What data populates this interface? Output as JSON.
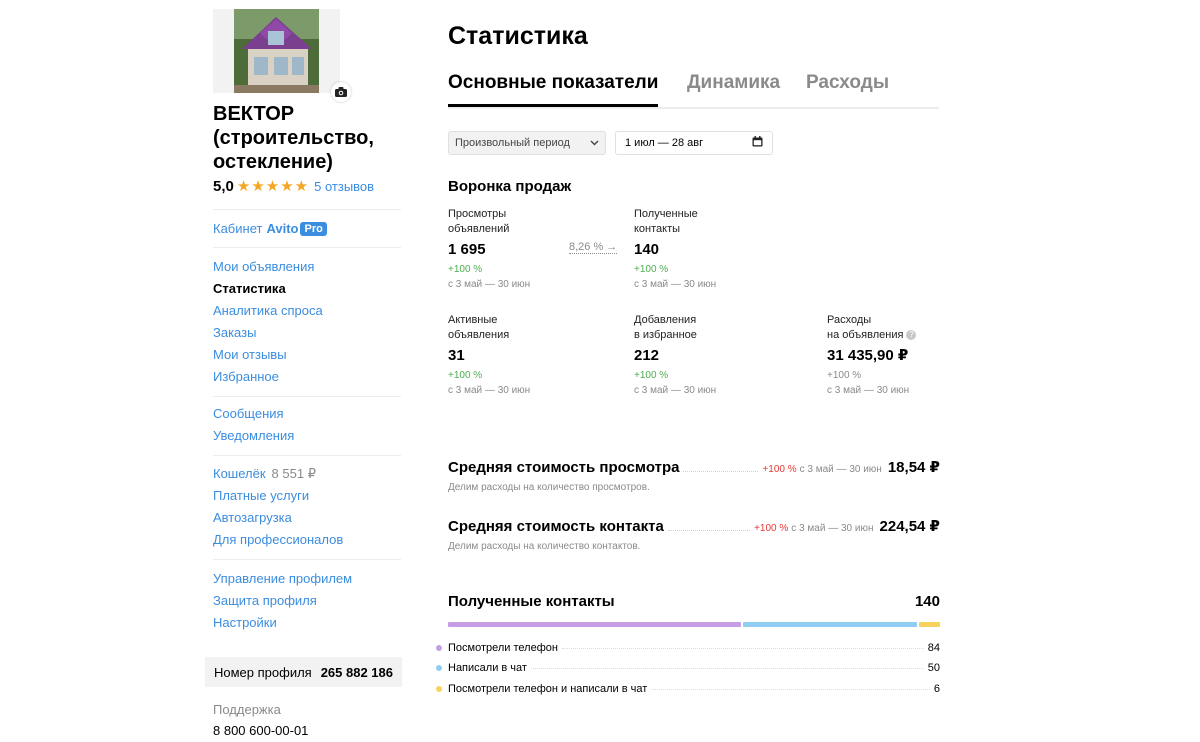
{
  "sidebar": {
    "company_name": "ВЕКТОР (строительство, остекление)",
    "rating": "5,0",
    "stars": 5,
    "reviews": "5 отзывов",
    "cabinet_label": "Кабинет",
    "cabinet_brand": "Avito",
    "cabinet_badge": "Pro",
    "nav_group1": [
      {
        "label": "Мои объявления",
        "active": false
      },
      {
        "label": "Статистика",
        "active": true
      },
      {
        "label": "Аналитика спроса",
        "active": false
      },
      {
        "label": "Заказы",
        "active": false
      },
      {
        "label": "Мои отзывы",
        "active": false
      },
      {
        "label": "Избранное",
        "active": false
      }
    ],
    "nav_group2": [
      {
        "label": "Сообщения"
      },
      {
        "label": "Уведомления"
      }
    ],
    "wallet_label": "Кошелёк",
    "wallet_amount": "8 551 ₽",
    "nav_group3": [
      {
        "label": "Платные услуги"
      },
      {
        "label": "Автозагрузка"
      },
      {
        "label": "Для профессионалов"
      }
    ],
    "nav_group4": [
      {
        "label": "Управление профилем"
      },
      {
        "label": "Защита профиля"
      },
      {
        "label": "Настройки"
      }
    ],
    "profile_label": "Номер профиля",
    "profile_number": "265 882 186",
    "support_label": "Поддержка",
    "support_phone": "8 800 600-00-01"
  },
  "main": {
    "title": "Статистика",
    "tabs": [
      {
        "label": "Основные показатели",
        "active": true
      },
      {
        "label": "Динамика",
        "active": false
      },
      {
        "label": "Расходы",
        "active": false
      }
    ],
    "period_select": "Произвольный период",
    "date_range": "1 июл — 28 авг",
    "funnel_title": "Воронка продаж",
    "conversion": "8,26 %",
    "metrics": [
      {
        "label1": "Просмотры",
        "label2": "объявлений",
        "value": "1 695",
        "change": "+100 %",
        "period": "с 3 май — 30 июн"
      },
      {
        "label1": "Полученные",
        "label2": "контакты",
        "value": "140",
        "change": "+100 %",
        "period": "с 3 май — 30 июн"
      },
      {
        "label1": "Активные",
        "label2": "объявления",
        "value": "31",
        "change": "+100 %",
        "period": "с 3 май — 30 июн"
      },
      {
        "label1": "Добавления",
        "label2": "в избранное",
        "value": "212",
        "change": "+100 %",
        "period": "с 3 май — 30 июн"
      },
      {
        "label1": "Расходы",
        "label2": "на объявления",
        "value": "31 435,90 ₽",
        "change": "+100 %",
        "period": "с 3 май — 30 июн"
      }
    ],
    "cost_view": {
      "title": "Средняя стоимость просмотра",
      "change": "+100 %",
      "period": "с 3 май — 30 июн",
      "value": "18,54 ₽",
      "desc": "Делим расходы на количество просмотров."
    },
    "cost_contact": {
      "title": "Средняя стоимость контакта",
      "change": "+100 %",
      "period": "с 3 май — 30 июн",
      "value": "224,54 ₽",
      "desc": "Делим расходы на количество контактов."
    },
    "contacts": {
      "title": "Полученные контакты",
      "total": "140",
      "items": [
        {
          "label": "Посмотрели телефон",
          "value": 84,
          "color": "#c59ee6"
        },
        {
          "label": "Написали в чат",
          "value": 50,
          "color": "#8fcdf2"
        },
        {
          "label": "Посмотрели телефон и написали в чат",
          "value": 6,
          "color": "#f7d35e"
        }
      ]
    }
  },
  "colors": {
    "link": "#3b8de0",
    "positive": "#4caf50",
    "negative": "#e53935",
    "star": "#f5a623"
  }
}
